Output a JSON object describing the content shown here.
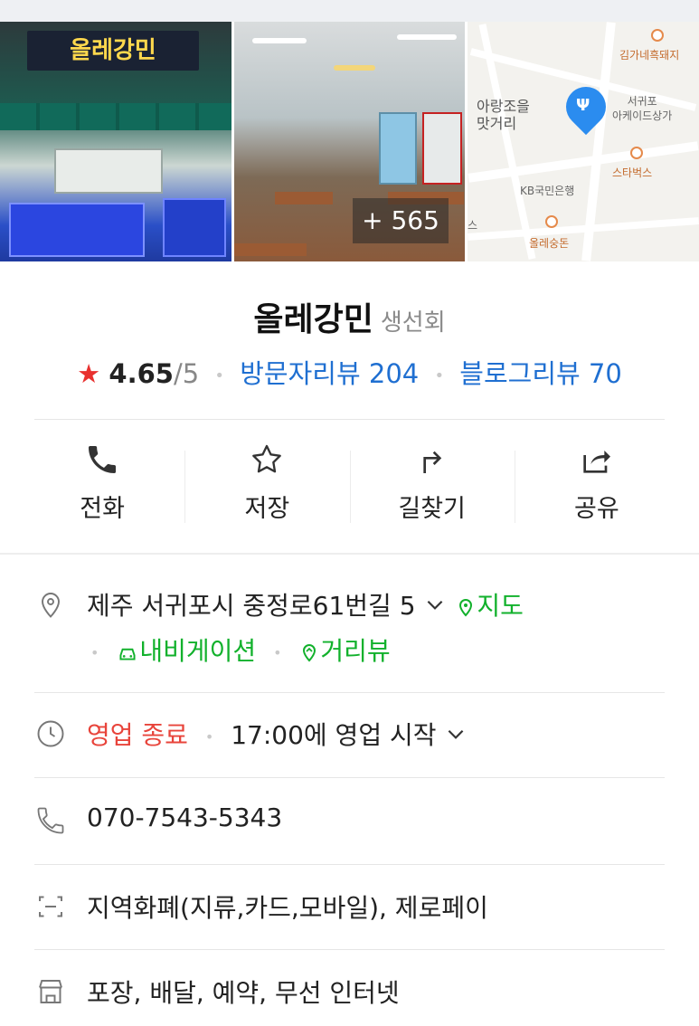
{
  "gallery": {
    "more_count": "+ 565",
    "photo1_sign": "올레강민",
    "map_labels": {
      "pork": "김가네흑돼지",
      "arcade": "서귀포\n아케이드상가",
      "arangjo": "아랑조을\n맛거리",
      "starbucks": "스타벅스",
      "kb": "KB국민은행",
      "olle": "올레숭돈",
      "street_view": "스"
    }
  },
  "place": {
    "name": "올레강민",
    "category": "생선회",
    "star_glyph": "★",
    "score": "4.65",
    "score_max": "/5",
    "visitor_reviews": "방문자리뷰 204",
    "blog_reviews": "블로그리뷰 70"
  },
  "actions": [
    {
      "label": "전화",
      "icon": "phone-icon"
    },
    {
      "label": "저장",
      "icon": "star-outline-icon"
    },
    {
      "label": "길찾기",
      "icon": "directions-icon"
    },
    {
      "label": "공유",
      "icon": "share-icon"
    }
  ],
  "info": {
    "address": "제주 서귀포시 중정로61번길 5",
    "map_link": "지도",
    "navigation_link": "내비게이션",
    "street_view_link": "거리뷰",
    "status": "영업 종료",
    "hours": "17:00에 영업 시작",
    "phone": "070-7543-5343",
    "payment": "지역화폐(지류,카드,모바일), 제로페이",
    "amenities": "포장, 배달, 예약, 무선 인터넷"
  },
  "colors": {
    "accent_green": "#12b12c",
    "link_blue": "#1f6fd1",
    "status_red": "#e8443b",
    "star_red": "#e8312f"
  }
}
